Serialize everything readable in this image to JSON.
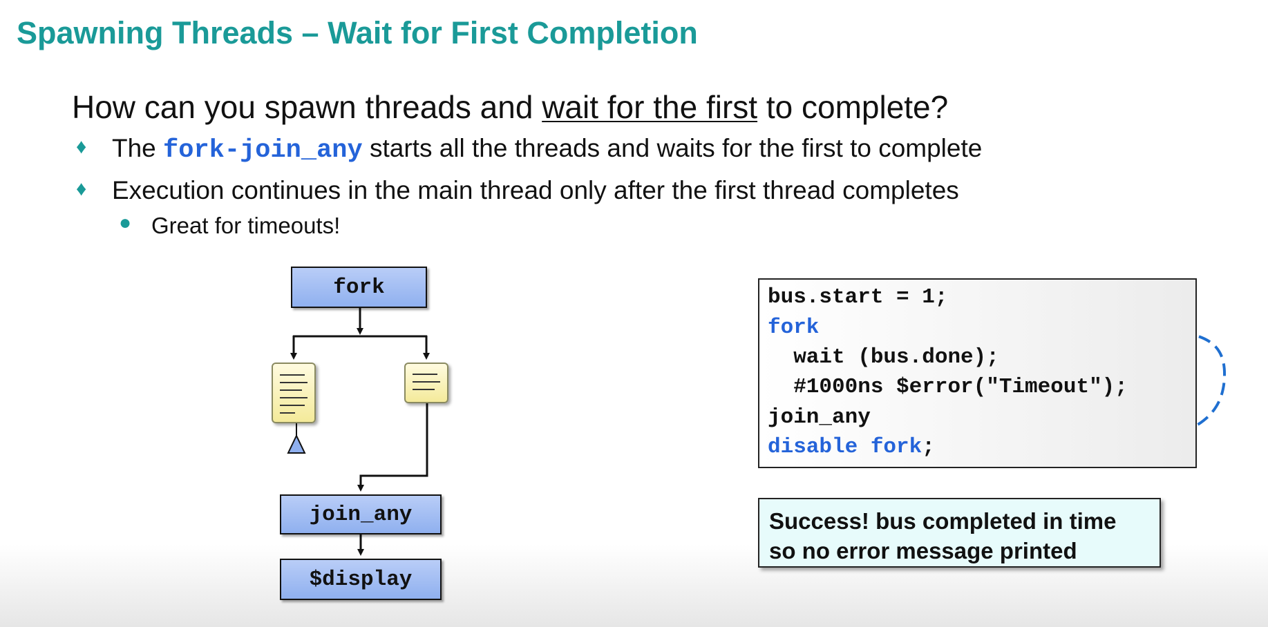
{
  "title": "Spawning Threads – Wait for First Completion",
  "question": {
    "before": "How can you spawn threads and ",
    "underlined": "wait for the first",
    "after": " to complete?"
  },
  "bullets": [
    {
      "marker": "♦",
      "before": "The ",
      "code": "fork-join_any",
      "after": " starts all the threads and waits for the first to complete"
    },
    {
      "marker": "♦",
      "text": "Execution continues in the main thread only after the first thread completes"
    }
  ],
  "sub_bullet": {
    "marker": "●",
    "text": "Great for timeouts!"
  },
  "diagram": {
    "fork_label": "fork",
    "join_label": "join_any",
    "display_label": "$display"
  },
  "code": {
    "line1": "bus.start = 1;",
    "line2": "fork",
    "line3": "  wait (bus.done);",
    "line4": "  #1000ns $error(\"Timeout\");",
    "line5": "join_any",
    "line6_kw": "disable fork",
    "line6_rest": ";"
  },
  "note": {
    "line1": "Success! bus completed in time",
    "line2": "so no error message printed"
  },
  "colors": {
    "title": "#1a9a98",
    "keyword": "#2463d9",
    "arrow": "#1f6fd0"
  }
}
